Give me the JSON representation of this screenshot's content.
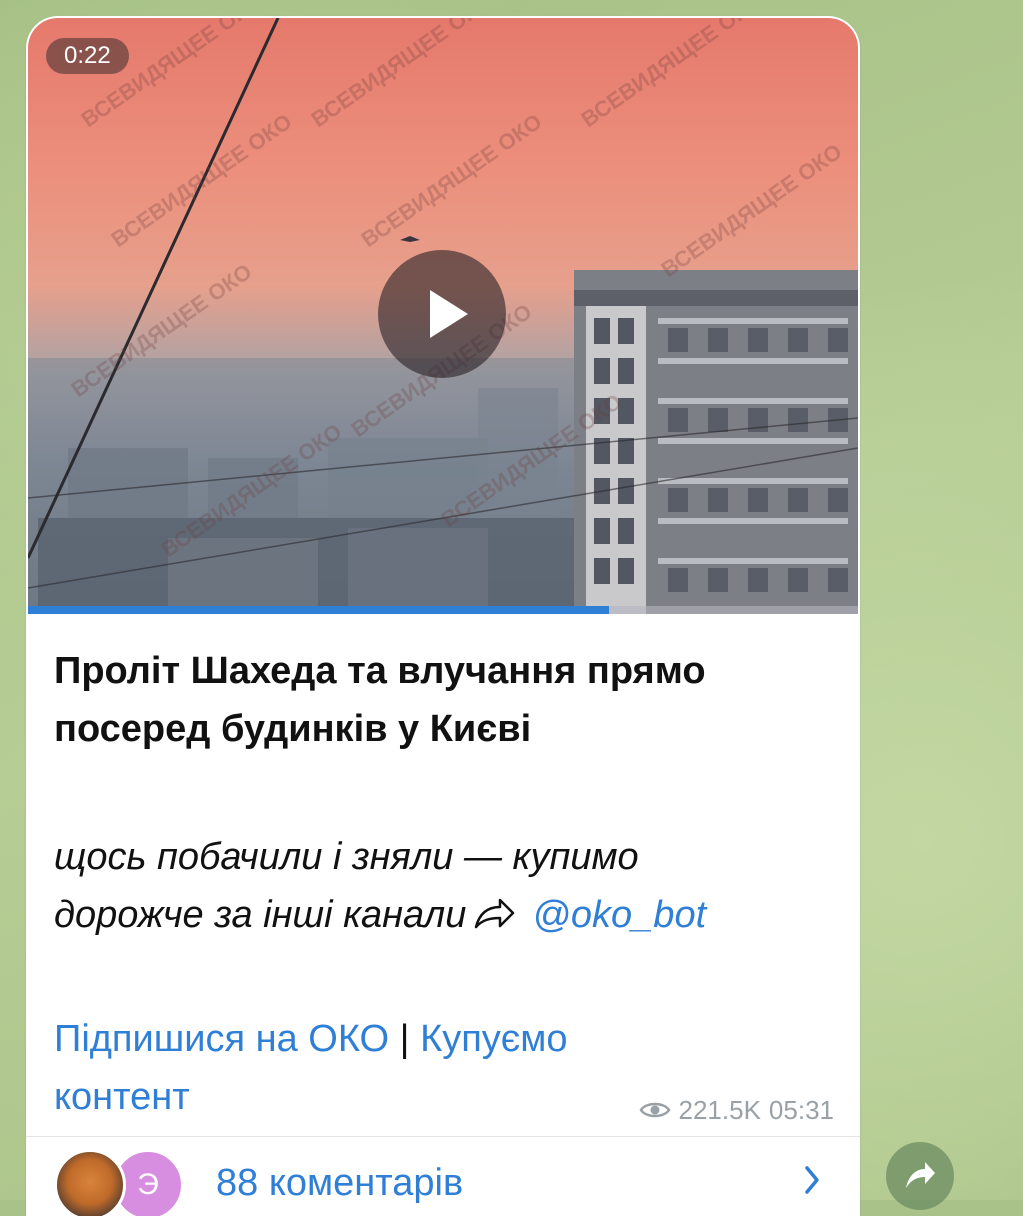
{
  "video": {
    "duration": "0:22",
    "watermark_text": "ВСЕВИДЯЩЕЕ ОКО",
    "progress_fraction": 0.7
  },
  "post": {
    "title_line1": "Проліт Шахеда та влучання прямо",
    "title_line2": "посеред будинків у Києві",
    "subtitle_line1": "щось побачили і зняли — купимо",
    "subtitle_line2_text": "дорожче за інші канали",
    "bot_link": "@oko_bot",
    "link_subscribe": "Підпишися на ОКО",
    "separator": "|",
    "link_buy_part1": "Купуємо",
    "link_buy_part2": "контент",
    "views": "221.5K",
    "time": "05:31"
  },
  "comments": {
    "avatar_letter": "Э",
    "label": "88 коментарів"
  },
  "colors": {
    "accent": "#2f7fd6",
    "meta": "#9aa1a6",
    "wallpaper": "#a9c289"
  },
  "icons": [
    "play-icon",
    "share-arrow-icon",
    "eye-icon",
    "chevron-right-icon",
    "share-icon"
  ]
}
